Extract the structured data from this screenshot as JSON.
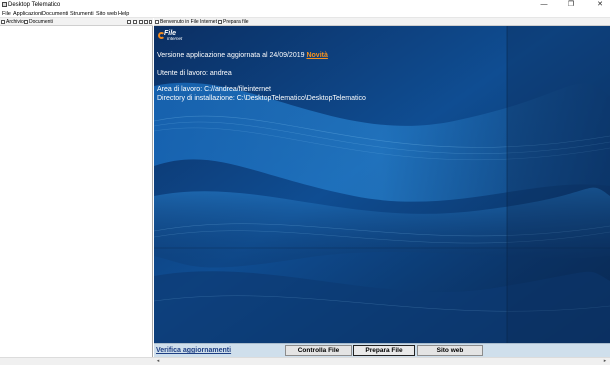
{
  "window": {
    "title": "Desktop Telematico",
    "minimize_glyph": "—",
    "maximize_glyph": "❐",
    "close_glyph": "✕"
  },
  "menu": [
    "File",
    "Applicazioni",
    "Documenti",
    "Strumenti",
    "Sito web",
    "Help"
  ],
  "left_panel": {
    "tabs": [
      {
        "label": "Archivio",
        "icon": "archive-icon"
      },
      {
        "label": "Documenti",
        "icon": "documents-icon"
      }
    ],
    "toolbar_icons": [
      "back-icon",
      "refresh-icon",
      "collapse-icon",
      "tree-icon",
      "panel-menu-icon"
    ]
  },
  "right_panel": {
    "tabs": [
      {
        "label": "Benvenuto in File Internet"
      },
      {
        "label": "Prepara file"
      }
    ],
    "logo": {
      "word1": "File",
      "word2": "Internet"
    },
    "info": {
      "version_text": "Versione applicazione aggiornata al 24/09/2019",
      "novita_link": "Novità",
      "user_line": "Utente di lavoro: andrea",
      "workspace_line": "Area di lavoro: C://andrea/fileinternet",
      "install_line": "Directory di installazione: C:\\DesktopTelematico\\DesktopTelematico"
    }
  },
  "bottom_bar": {
    "verifica_link": "Verifica aggiornamenti",
    "buttons": [
      "Controlla File",
      "Prepara File",
      "Sito web"
    ]
  },
  "scrollbar": {
    "left_arrow": "◂",
    "right_arrow": "▸"
  },
  "colors": {
    "background_blue": "#0a2d5e",
    "accent_orange": "#f7931e",
    "link_blue": "#1e3f84",
    "bottom_bar": "#cfdfec"
  }
}
